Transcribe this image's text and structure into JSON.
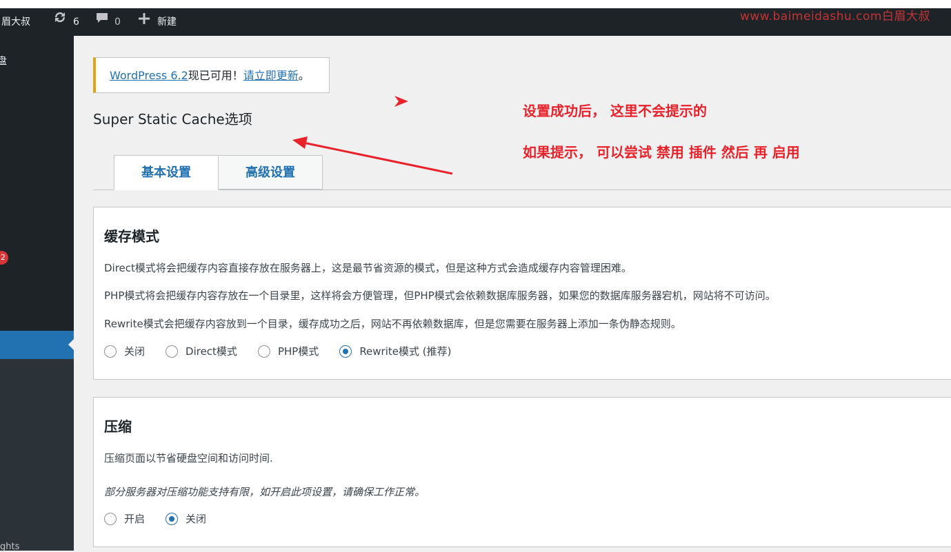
{
  "adminbar": {
    "site_name": "白眉大叔",
    "updates_count": "6",
    "comments_count": "0",
    "new_label": "新建",
    "watermark": "www.baimeidashu.com白眉大叔"
  },
  "sidebar": {
    "top_text": "盘",
    "badge": "2",
    "bottom_text": "ghts"
  },
  "notice": {
    "link_text": "WordPress 6.2",
    "middle_text": "现已可用！",
    "update_link": "请立即更新",
    "end_text": "。"
  },
  "page": {
    "title": "Super Static Cache选项"
  },
  "tabs": [
    {
      "label": "基本设置",
      "active": true
    },
    {
      "label": "高级设置",
      "active": false
    }
  ],
  "cache_panel": {
    "heading": "缓存模式",
    "desc1": "Direct模式将会把缓存内容直接存放在服务器上，这是最节省资源的模式，但是这种方式会造成缓存内容管理困难。",
    "desc2": "PHP模式将会把缓存内容存放在一个目录里，这样将会方便管理，但PHP模式会依赖数据库服务器，如果您的数据库服务器宕机，网站将不可访问。",
    "desc3": "Rewrite模式会把缓存内容放到一个目录，缓存成功之后，网站不再依赖数据库，但是您需要在服务器上添加一条伪静态规则。",
    "options": [
      {
        "label": "关闭",
        "checked": false
      },
      {
        "label": "Direct模式",
        "checked": false
      },
      {
        "label": "PHP模式",
        "checked": false
      },
      {
        "label": "Rewrite模式 (推荐)",
        "checked": true
      }
    ]
  },
  "compress_panel": {
    "heading": "压缩",
    "desc1": "压缩页面以节省硬盘空间和访问时间.",
    "desc2": "部分服务器对压缩功能支持有限，如开启此项设置，请确保工作正常。",
    "options": [
      {
        "label": "开启",
        "checked": false
      },
      {
        "label": "关闭",
        "checked": true
      }
    ]
  },
  "annotations": {
    "line1": "设置成功后， 这里不会提示的",
    "line2": "如果提示， 可以尝试 禁用 插件 然后 再 启用",
    "color": "#e8222a"
  },
  "colors": {
    "admin_bar": "#1d2327",
    "accent": "#2271b1",
    "notice_warning": "#dba617",
    "badge": "#d63638"
  }
}
